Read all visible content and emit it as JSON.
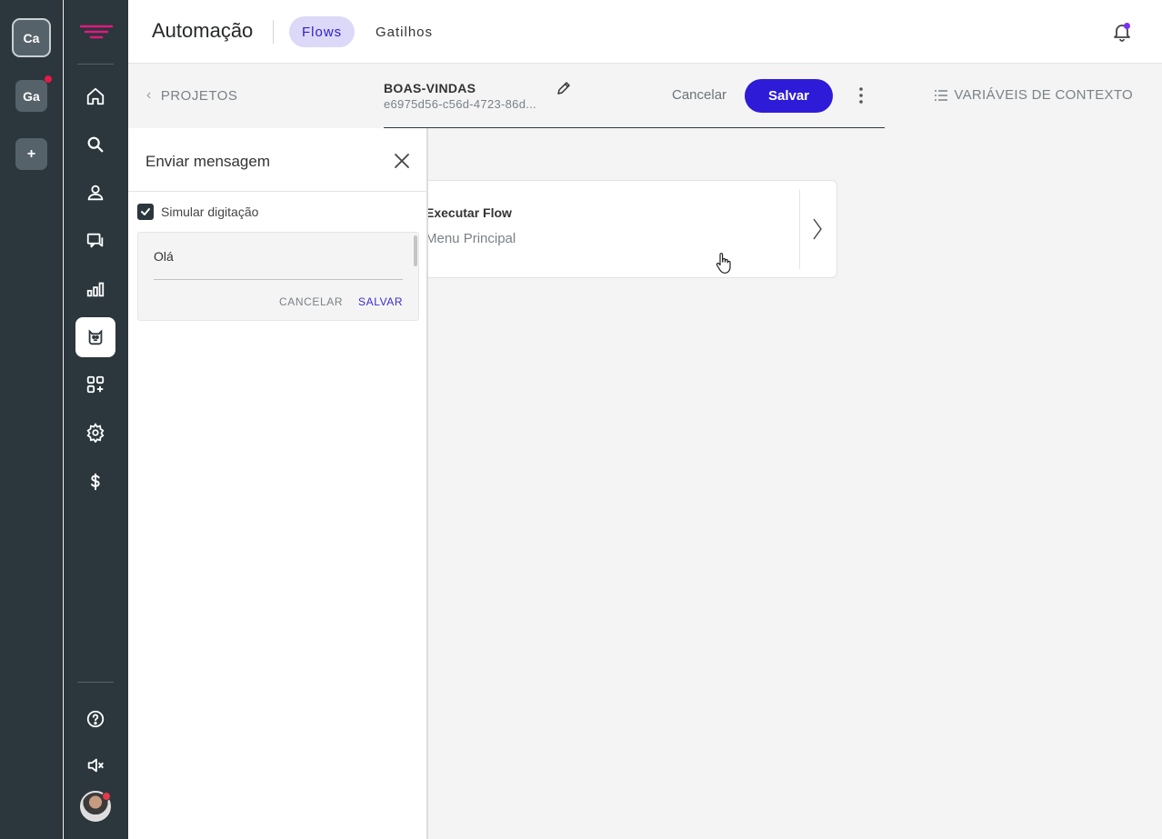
{
  "workspaces": [
    {
      "label": "Ca",
      "active": true
    },
    {
      "label": "Ga",
      "active": false
    },
    {
      "label": "+",
      "active": false
    }
  ],
  "nav": {
    "icons": [
      "home-icon",
      "search-icon",
      "contacts-icon",
      "conversations-icon",
      "reports-icon",
      "bot-icon",
      "integrations-icon",
      "settings-icon",
      "billing-icon"
    ],
    "bottom_icons": [
      "help-icon",
      "mute-icon"
    ],
    "active": "bot-icon"
  },
  "header": {
    "title": "Automação",
    "tabs": [
      "Flows",
      "Gatilhos"
    ],
    "active_tab": "Flows"
  },
  "subheader": {
    "back_label": "PROJETOS",
    "flow_name": "BOAS-VINDAS",
    "flow_id": "e6975d56-c56d-4723-86d...",
    "cancel_label": "Cancelar",
    "save_label": "Salvar",
    "vars_label": "VARIÁVEIS DE CONTEXTO"
  },
  "card": {
    "title": "Executar Flow",
    "subtitle": "Menu Principal"
  },
  "panel": {
    "title": "Enviar mensagem",
    "checkbox_label": "Simular digitação",
    "checkbox_checked": true,
    "message_value": "Olá",
    "cancel_label": "CANCELAR",
    "save_label": "SALVAR"
  },
  "colors": {
    "sidebar": "#2b363d",
    "primary": "#2d1bd8",
    "tab_active_bg": "#dcd8f8",
    "badge": "#e6194b"
  }
}
